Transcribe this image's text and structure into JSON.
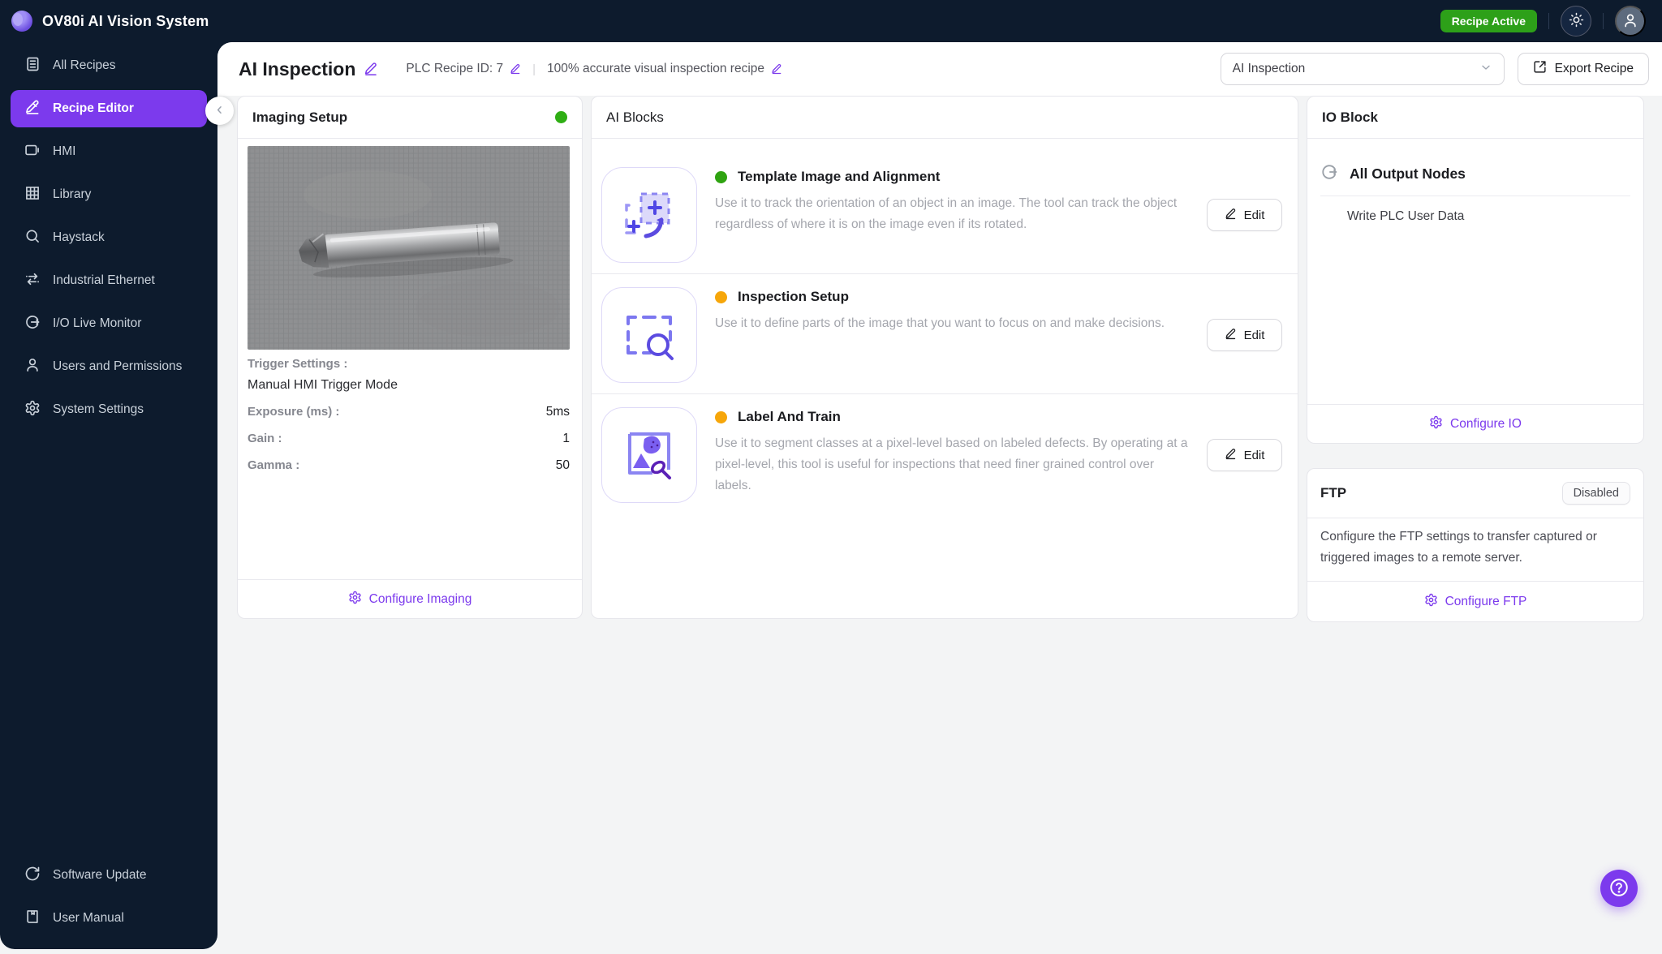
{
  "topbar": {
    "app_title": "OV80i AI Vision System",
    "recipe_status": "Recipe Active",
    "icons": [
      "brightness-icon",
      "user-avatar-icon"
    ]
  },
  "sidebar": {
    "items": [
      {
        "label": "All Recipes",
        "icon": "recipes-list-icon",
        "active": false
      },
      {
        "label": "Recipe Editor",
        "icon": "pencil-icon",
        "active": true
      },
      {
        "label": "HMI",
        "icon": "hmi-display-icon",
        "active": false
      },
      {
        "label": "Library",
        "icon": "grid-icon",
        "active": false
      },
      {
        "label": "Haystack",
        "icon": "search-icon",
        "active": false
      },
      {
        "label": "Industrial Ethernet",
        "icon": "ethernet-arrows-icon",
        "active": false
      },
      {
        "label": "I/O Live Monitor",
        "icon": "circle-arrow-icon",
        "active": false
      },
      {
        "label": "Users and Permissions",
        "icon": "user-icon",
        "active": false
      },
      {
        "label": "System Settings",
        "icon": "gear-icon",
        "active": false
      }
    ],
    "bottom_items": [
      {
        "label": "Software Update",
        "icon": "refresh-icon"
      },
      {
        "label": "User Manual",
        "icon": "book-icon"
      }
    ]
  },
  "header": {
    "title": "AI Inspection",
    "plc_label": "PLC Recipe ID: 7",
    "separator": "|",
    "subtitle": "100% accurate visual inspection recipe",
    "recipe_select_value": "AI Inspection",
    "export_label": "Export Recipe"
  },
  "imaging": {
    "title": "Imaging Setup",
    "status_color": "#2fae14",
    "trigger_label": "Trigger Settings :",
    "trigger_mode": "Manual HMI Trigger Mode",
    "rows": [
      {
        "label": "Exposure (ms) :",
        "value": "5ms"
      },
      {
        "label": "Gain :",
        "value": "1"
      },
      {
        "label": "Gamma :",
        "value": "50"
      }
    ],
    "configure_label": "Configure Imaging"
  },
  "ai_blocks": {
    "title": "AI Blocks",
    "edit_label": "Edit",
    "blocks": [
      {
        "name": "Template Image and Alignment",
        "status_color": "#2fa311",
        "icon": "template-alignment-icon",
        "description": "Use it to track the orientation of an object in an image. The tool can track the object regardless of where it is on the image even if its rotated."
      },
      {
        "name": "Inspection Setup",
        "status_color": "#f6a60a",
        "icon": "inspection-magnifier-icon",
        "description": "Use it to define parts of the image that you want to focus on and make decisions."
      },
      {
        "name": "Label And Train",
        "status_color": "#f6a60a",
        "icon": "label-brush-icon",
        "description": "Use it to segment classes at a pixel-level based on labeled defects. By operating at a pixel-level, this tool is useful for inspections that need finer grained control over labels."
      }
    ]
  },
  "io_block": {
    "title": "IO Block",
    "group_label": "All Output Nodes",
    "group_icon": "circle-arrow-icon",
    "nodes": [
      "Write PLC User Data"
    ],
    "configure_label": "Configure IO"
  },
  "ftp": {
    "title": "FTP",
    "status": "Disabled",
    "description": "Configure the FTP settings to transfer captured or triggered images to a remote server.",
    "configure_label": "Configure FTP"
  },
  "colors": {
    "accent": "#7c3aed",
    "dark": "#0d1b2d",
    "badge_green": "#2da019"
  }
}
